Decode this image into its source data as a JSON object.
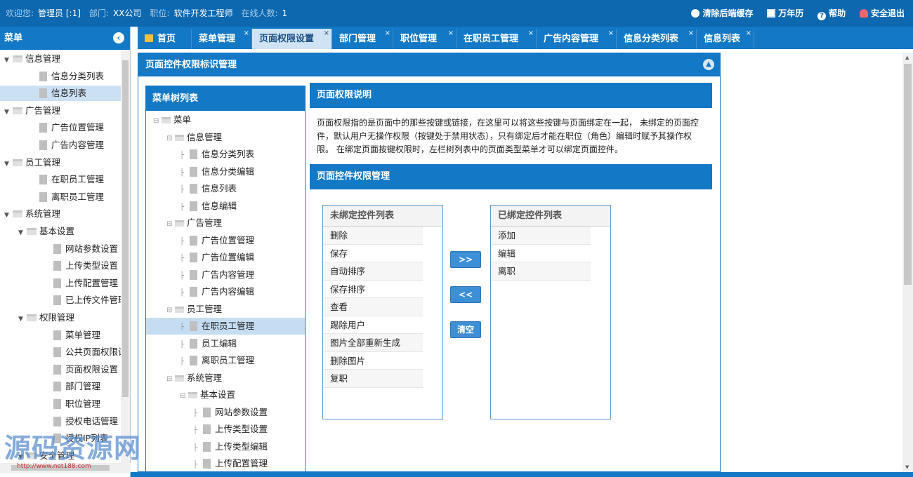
{
  "topbar": {
    "welcome_label": "欢迎您:",
    "user": "管理员 [:1]",
    "dept_label": "部门:",
    "dept": "XX公司",
    "position_label": "职位:",
    "position": "软件开发工程师",
    "online_label": "在线人数:",
    "online": "1",
    "actions": [
      {
        "label": "清除后端缓存",
        "icon": "clear-cache-icon"
      },
      {
        "label": "万年历",
        "icon": "calendar-icon"
      },
      {
        "label": "帮助",
        "icon": "help-icon"
      },
      {
        "label": "安全退出",
        "icon": "logout-icon"
      }
    ]
  },
  "sidebar": {
    "title": "菜单",
    "items": [
      {
        "label": "信息管理",
        "level": 0,
        "type": "folder"
      },
      {
        "label": "信息分类列表",
        "level": 1,
        "type": "file"
      },
      {
        "label": "信息列表",
        "level": 1,
        "type": "file",
        "selected": true
      },
      {
        "label": "广告管理",
        "level": 0,
        "type": "folder"
      },
      {
        "label": "广告位置管理",
        "level": 1,
        "type": "file"
      },
      {
        "label": "广告内容管理",
        "level": 1,
        "type": "file"
      },
      {
        "label": "员工管理",
        "level": 0,
        "type": "folder"
      },
      {
        "label": "在职员工管理",
        "level": 1,
        "type": "file"
      },
      {
        "label": "离职员工管理",
        "level": 1,
        "type": "file"
      },
      {
        "label": "系统管理",
        "level": 0,
        "type": "folder"
      },
      {
        "label": "基本设置",
        "level": 1,
        "type": "folder"
      },
      {
        "label": "网站参数设置",
        "level": 2,
        "type": "file"
      },
      {
        "label": "上传类型设置",
        "level": 2,
        "type": "file"
      },
      {
        "label": "上传配置管理",
        "level": 2,
        "type": "file"
      },
      {
        "label": "已上传文件管理",
        "level": 2,
        "type": "file"
      },
      {
        "label": "权限管理",
        "level": 1,
        "type": "folder"
      },
      {
        "label": "菜单管理",
        "level": 2,
        "type": "file"
      },
      {
        "label": "公共页面权限设置",
        "level": 2,
        "type": "file"
      },
      {
        "label": "页面权限设置",
        "level": 2,
        "type": "file"
      },
      {
        "label": "部门管理",
        "level": 2,
        "type": "file"
      },
      {
        "label": "职位管理",
        "level": 2,
        "type": "file"
      },
      {
        "label": "授权电话管理",
        "level": 2,
        "type": "file"
      },
      {
        "label": "授权IP列表",
        "level": 2,
        "type": "file"
      },
      {
        "label": "安全管理",
        "level": 1,
        "type": "folder"
      }
    ]
  },
  "tabs": [
    {
      "label": "首页",
      "home": true
    },
    {
      "label": "菜单管理"
    },
    {
      "label": "页面权限设置",
      "active": true
    },
    {
      "label": "部门管理"
    },
    {
      "label": "职位管理"
    },
    {
      "label": "在职员工管理"
    },
    {
      "label": "广告内容管理"
    },
    {
      "label": "信息分类列表"
    },
    {
      "label": "信息列表"
    }
  ],
  "tab_close": "×",
  "panel": {
    "title": "页面控件权限标识管理",
    "menu_tree_title": "菜单树列表",
    "menu_tree": [
      {
        "label": "菜单",
        "level": 0,
        "type": "folder"
      },
      {
        "label": "信息管理",
        "level": 1,
        "type": "folder"
      },
      {
        "label": "信息分类列表",
        "level": 2,
        "type": "file"
      },
      {
        "label": "信息分类编辑",
        "level": 2,
        "type": "file"
      },
      {
        "label": "信息列表",
        "level": 2,
        "type": "file"
      },
      {
        "label": "信息编辑",
        "level": 2,
        "type": "file"
      },
      {
        "label": "广告管理",
        "level": 1,
        "type": "folder"
      },
      {
        "label": "广告位置管理",
        "level": 2,
        "type": "file"
      },
      {
        "label": "广告位置编辑",
        "level": 2,
        "type": "file"
      },
      {
        "label": "广告内容管理",
        "level": 2,
        "type": "file"
      },
      {
        "label": "广告内容编辑",
        "level": 2,
        "type": "file"
      },
      {
        "label": "员工管理",
        "level": 1,
        "type": "folder"
      },
      {
        "label": "在职员工管理",
        "level": 2,
        "type": "file",
        "selected": true
      },
      {
        "label": "员工编辑",
        "level": 2,
        "type": "file"
      },
      {
        "label": "离职员工管理",
        "level": 2,
        "type": "file"
      },
      {
        "label": "系统管理",
        "level": 1,
        "type": "folder"
      },
      {
        "label": "基本设置",
        "level": 2,
        "type": "folder"
      },
      {
        "label": "网站参数设置",
        "level": 3,
        "type": "file"
      },
      {
        "label": "上传类型设置",
        "level": 3,
        "type": "file"
      },
      {
        "label": "上传类型编辑",
        "level": 3,
        "type": "file"
      },
      {
        "label": "上传配置管理",
        "level": 3,
        "type": "file"
      }
    ],
    "explain_title": "页面权限说明",
    "explain_text": "页面权限指的是页面中的那些按键或链接，在这里可以将这些按键与页面绑定在一起， 未绑定的页面控件，默认用户无操作权限（按键处于禁用状态），只有绑定后才能在职位（角色）编辑时赋予其操作权限。 在绑定页面按键权限时，左栏树列表中的页面类型菜单才可以绑定页面控件。",
    "manage_title": "页面控件权限管理",
    "unbound_title": "未绑定控件列表",
    "unbound": [
      "删除",
      "保存",
      "自动排序",
      "保存排序",
      "查看",
      "踢除用户",
      "图片全部重新生成",
      "删除图片",
      "复职"
    ],
    "bound_title": "已绑定控件列表",
    "bound": [
      "添加",
      "编辑",
      "离职"
    ],
    "btn_bind": ">>",
    "btn_unbind": "<<",
    "btn_clear": "清空"
  },
  "watermark": {
    "text": "源码资源网",
    "url": "http://www.net188.com"
  }
}
